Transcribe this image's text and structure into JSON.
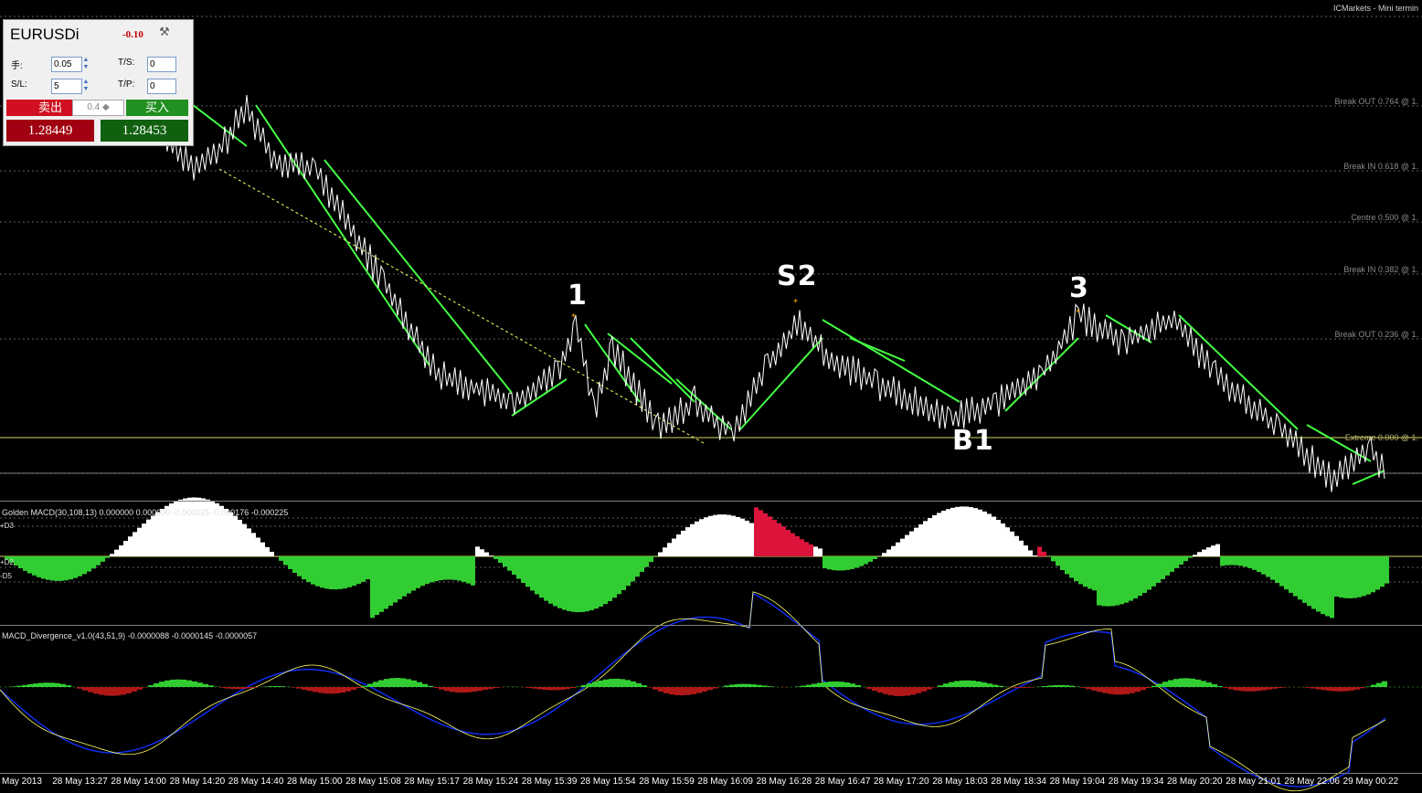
{
  "window": {
    "broker_title": "ICMarkets - Mini termin"
  },
  "trade_panel": {
    "symbol": "EURUSDi",
    "change": "-0.10",
    "tools_icon": "tools-icon",
    "lots_label": "手:",
    "lots_value": "0.05",
    "sl_label": "S/L:",
    "sl_value": "5",
    "ts_label": "T/S:",
    "ts_value": "0",
    "tp_label": "T/P:",
    "tp_value": "0",
    "sell_label": "卖出",
    "buy_label": "买入",
    "lot_step": "0.4",
    "bid": "1.28449",
    "ask": "1.28453"
  },
  "price_levels": [
    {
      "label": "Break OUT 0.764 @ 1.",
      "y_frac": 0.0
    },
    {
      "label": "Break IN 0.618 @ 1.",
      "y_frac": 0.0
    },
    {
      "label": "Centre 0.500 @ 1.",
      "y_frac": 0.0
    },
    {
      "label": "Break IN 0.382 @ 1.",
      "y_frac": 0.0
    },
    {
      "label": "Break OUT 0.236 @ 1.",
      "y_frac": 0.0
    },
    {
      "label": "Extreme 0.000 @ 1.",
      "y_frac": 0.0
    }
  ],
  "annotations": [
    "1",
    "S2",
    "3",
    "B1"
  ],
  "indicators": {
    "golden_macd": "Golden MACD(30,108,13) 0.000000 0.000000 -0.000225 -0.000176 -0.000225",
    "golden_side": [
      "+D3",
      "+D2",
      "-D5"
    ],
    "macd_divergence": "MACD_Divergence_v1.0(43,51,9) -0.0000088 -0.0000145 -0.0000057"
  },
  "time_axis": [
    "May 2013",
    "28 May 13:27",
    "28 May 14:00",
    "28 May 14:20",
    "28 May 14:40",
    "28 May 15:00",
    "28 May 15:08",
    "28 May 15:17",
    "28 May 15:24",
    "28 May 15:39",
    "28 May 15:54",
    "28 May 15:59",
    "28 May 16:09",
    "28 May 16:28",
    "28 May 16:47",
    "28 May 17:20",
    "28 May 18:03",
    "28 May 18:34",
    "28 May 19:04",
    "28 May 19:34",
    "28 May 20:20",
    "28 May 21:01",
    "28 May 22:06",
    "29 May 00:22"
  ],
  "colors": {
    "background": "#000000",
    "price_line": "#ffffff",
    "trend_green": "#44ff44",
    "macd_red": "#dc143c",
    "macd_green": "#32cd32",
    "signal_blue": "#1030ff",
    "signal_yellow": "#ffff66",
    "level_grey": "#808080",
    "extreme_yellow": "#d8d860",
    "arrow_orange": "#ffaa00"
  }
}
